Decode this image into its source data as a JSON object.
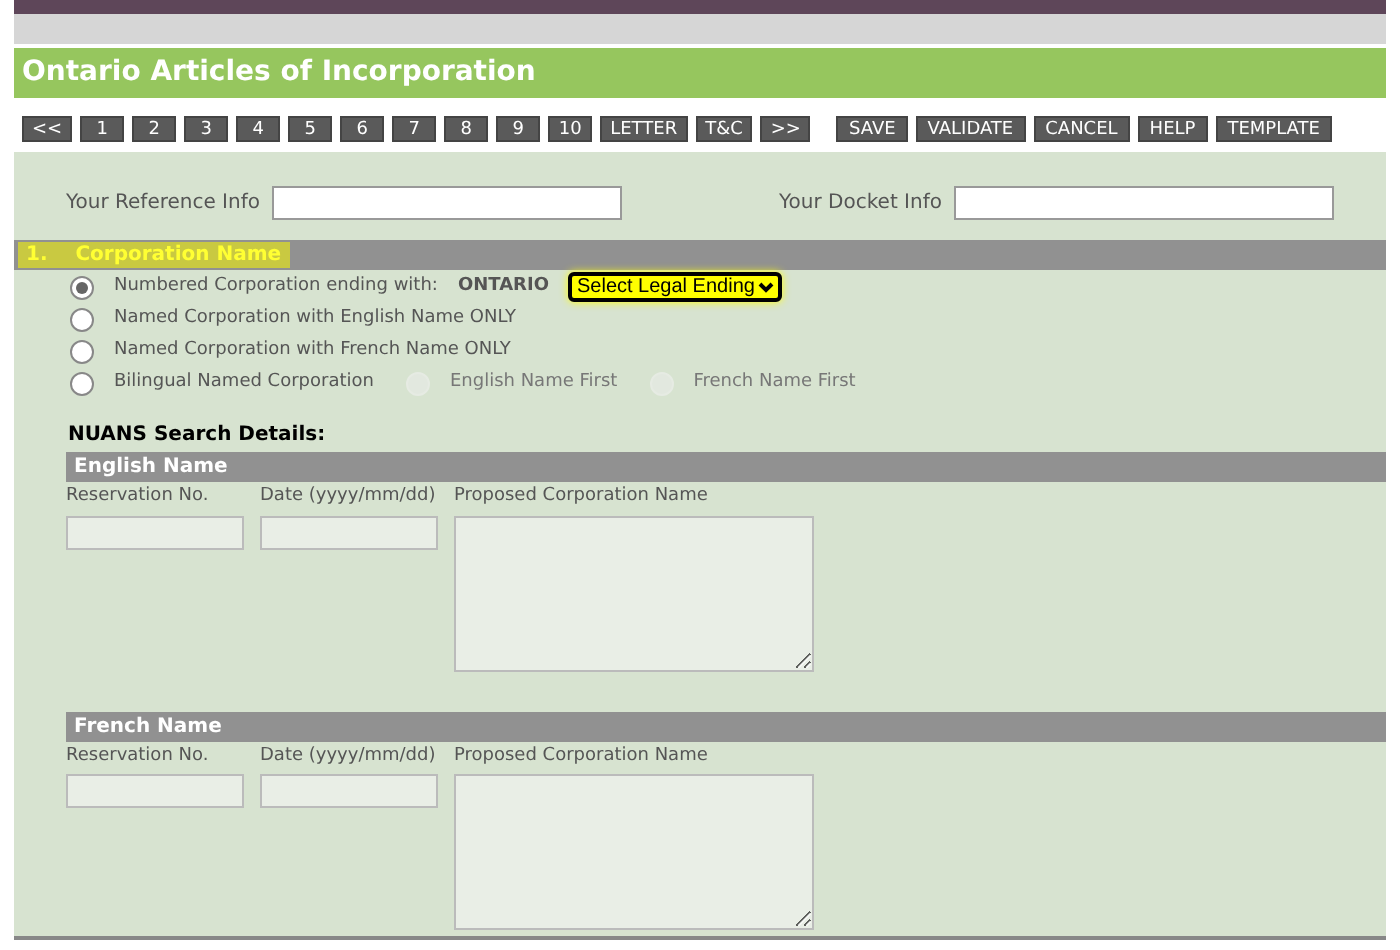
{
  "title": "Ontario Articles of Incorporation",
  "nav_buttons": [
    "<<",
    "1",
    "2",
    "3",
    "4",
    "5",
    "6",
    "7",
    "8",
    "9",
    "10",
    "LETTER",
    "T&C",
    ">>"
  ],
  "action_buttons": [
    "SAVE",
    "VALIDATE",
    "CANCEL",
    "HELP",
    "TEMPLATE"
  ],
  "reference": {
    "label": "Your Reference Info"
  },
  "docket": {
    "label": "Your Docket Info"
  },
  "section": {
    "number": "1.",
    "title": "Corporation Name"
  },
  "options": [
    {
      "label": "Numbered Corporation ending with:",
      "selected": true,
      "suffix": "ONTARIO",
      "select": "Select Legal Ending"
    },
    {
      "label": "Named Corporation with English Name ONLY",
      "selected": false
    },
    {
      "label": "Named Corporation with French Name ONLY",
      "selected": false
    },
    {
      "label": "Bilingual Named Corporation",
      "selected": false,
      "sub_options": [
        {
          "label": "English Name First",
          "selected": false,
          "disabled": true
        },
        {
          "label": "French Name First",
          "selected": false,
          "disabled": true
        }
      ]
    }
  ],
  "nuans": {
    "heading": "NUANS Search Details:",
    "groups": [
      {
        "title": "English Name",
        "columns": [
          "Reservation No.",
          "Date (yyyy/mm/dd)",
          "Proposed Corporation Name"
        ]
      },
      {
        "title": "French Name",
        "columns": [
          "Reservation No.",
          "Date (yyyy/mm/dd)",
          "Proposed Corporation Name"
        ]
      }
    ]
  }
}
